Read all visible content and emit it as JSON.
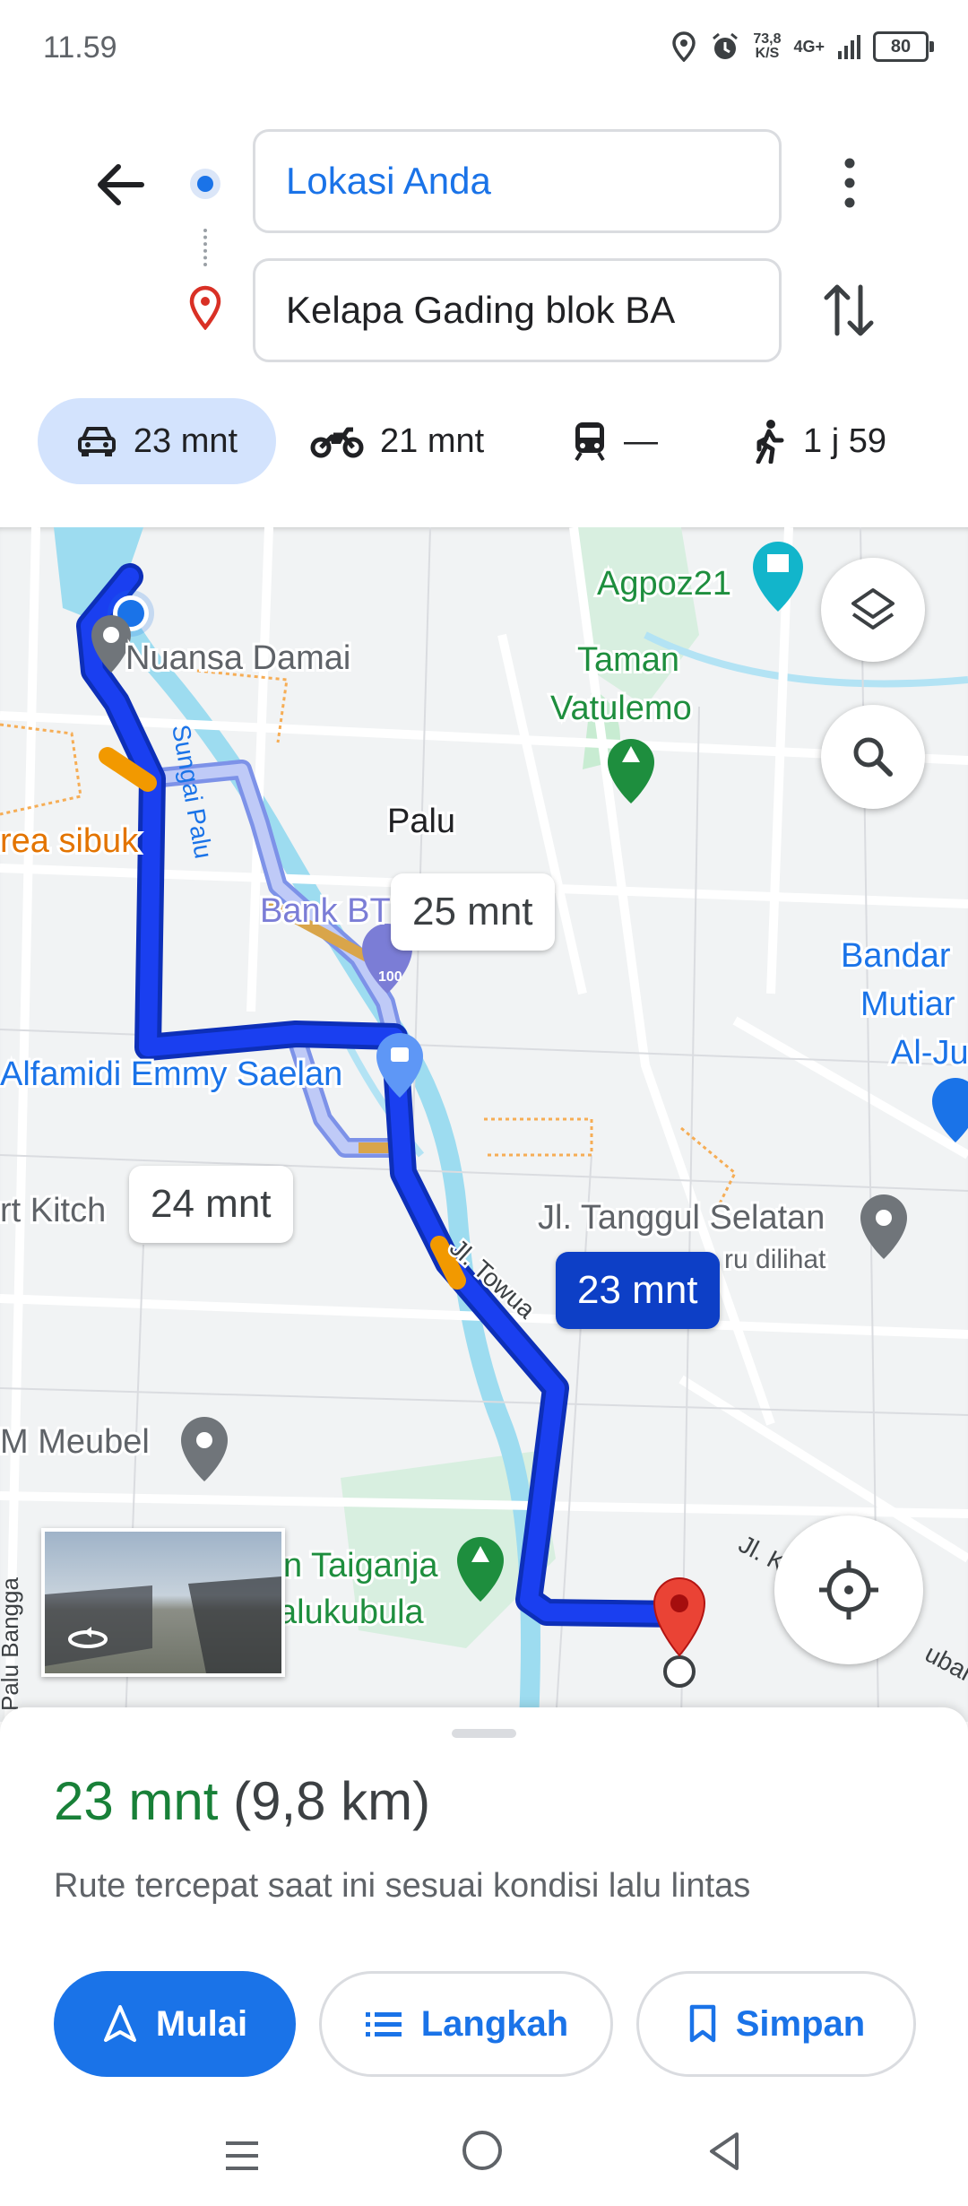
{
  "status_bar": {
    "time": "11.59",
    "net_speed_value": "73,8",
    "net_speed_unit": "K/S",
    "network": "4G+",
    "battery": "80"
  },
  "directions": {
    "origin": "Lokasi Anda",
    "destination": "Kelapa Gading blok BA"
  },
  "modes": [
    {
      "id": "car",
      "label": "23 mnt",
      "selected": true
    },
    {
      "id": "motorcycle",
      "label": "21 mnt",
      "selected": false
    },
    {
      "id": "transit",
      "label": "—",
      "selected": false
    },
    {
      "id": "walk",
      "label": "1 j 59",
      "selected": false
    }
  ],
  "map": {
    "labels": {
      "agpoz": "Agpoz21",
      "taman": "Taman",
      "vatulemo": "Vatulemo",
      "nuansa": "Nuansa Damai",
      "sungai": "Sungai Palu",
      "palu": "Palu",
      "area_sibuk": "rea sibuk",
      "bank": "Bank BT",
      "alfamidi": "Alfamidi Emmy Saelan",
      "bandar1": "Bandar",
      "bandar2": "Mutiar",
      "bandar3": "Al-Ju",
      "kitchen": "rt Kitch",
      "tanggul": "Jl. Tanggul Selatan",
      "baru": "ru dilihat",
      "towua": "Jl. Towua",
      "meubel": "M Meubel",
      "taiganja": "n Taiganja",
      "lalukubula": "alukubula",
      "jl_k": "Jl. K",
      "ubah": "ubah",
      "palu_bangga": "Palu Bangga",
      "poi_100": "100"
    },
    "route_times": {
      "alt1": "25 mnt",
      "alt2": "24 mnt",
      "main": "23 mnt"
    },
    "colors": {
      "route_main": "#1a3ff0",
      "route_alt": "#a8b8f0",
      "traffic_slow": "#f29900",
      "water": "#9ddcf0",
      "park": "#c8ecd2"
    }
  },
  "summary": {
    "duration": "23 mnt",
    "distance": "(9,8 km)",
    "note": "Rute tercepat saat ini sesuai kondisi lalu lintas"
  },
  "actions": {
    "start": "Mulai",
    "steps": "Langkah",
    "save": "Simpan"
  }
}
